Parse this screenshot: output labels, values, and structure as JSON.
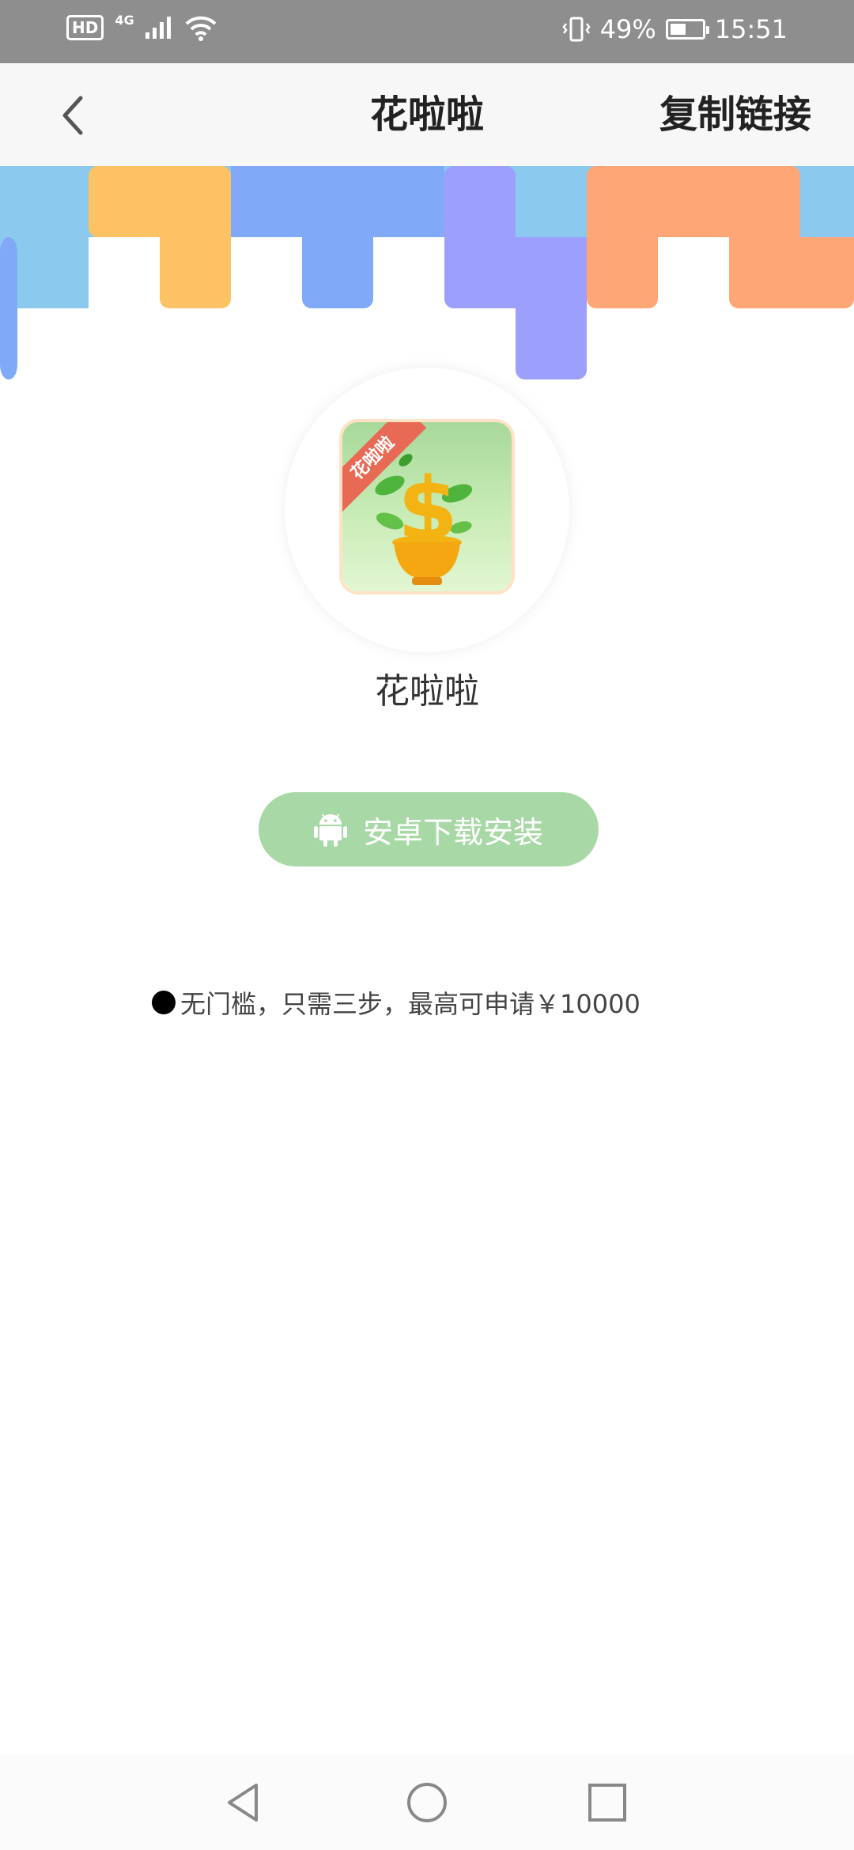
{
  "status_bar": {
    "hd": "HD",
    "network": "4G",
    "battery_percent": "49%",
    "battery_level": 0.49,
    "time": "15:51"
  },
  "nav": {
    "title": "花啦啦",
    "copy_link": "复制链接"
  },
  "app": {
    "ribbon_text": "花啦啦",
    "name": "花啦啦",
    "download_label": "安卓下载安装",
    "feature_text": "无门槛，只需三步，最高可申请￥10000"
  },
  "colors": {
    "download_button": "#a9d8a7",
    "banner_blue": "#8cc9ee",
    "banner_yellow": "#fdc263",
    "banner_periwinkle": "#80aaf8",
    "banner_purple": "#9d9ffd",
    "banner_orange": "#ffa677"
  },
  "icons": {
    "back": "chevron-left-icon",
    "android": "android-icon",
    "sys_back": "triangle-back-icon",
    "sys_home": "circle-home-icon",
    "sys_recent": "square-recent-icon"
  }
}
